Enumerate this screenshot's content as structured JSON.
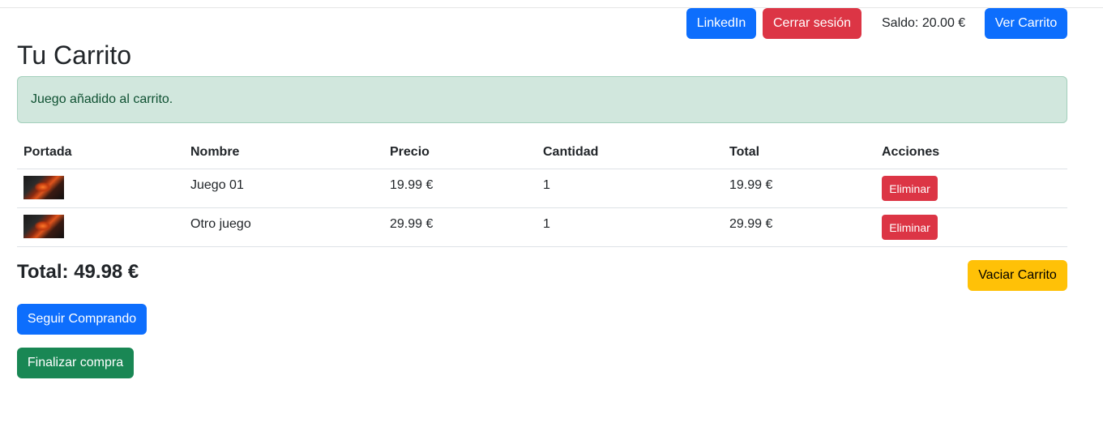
{
  "header": {
    "linkedin_label": "LinkedIn",
    "logout_label": "Cerrar sesión",
    "balance_text": "Saldo: 20.00 €",
    "view_cart_label": "Ver Carrito"
  },
  "page": {
    "title": "Tu Carrito"
  },
  "alert": {
    "message": "Juego añadido al carrito."
  },
  "table": {
    "columns": [
      "Portada",
      "Nombre",
      "Precio",
      "Cantidad",
      "Total",
      "Acciones"
    ],
    "rows": [
      {
        "name": "Juego 01",
        "price": "19.99 €",
        "quantity": "1",
        "total": "19.99 €",
        "action_label": "Eliminar"
      },
      {
        "name": "Otro juego",
        "price": "29.99 €",
        "quantity": "1",
        "total": "29.99 €",
        "action_label": "Eliminar"
      }
    ]
  },
  "summary": {
    "total_text": "Total: 49.98 €",
    "empty_cart_label": "Vaciar Carrito",
    "continue_label": "Seguir Comprando",
    "checkout_label": "Finalizar compra"
  },
  "colors": {
    "primary": "#0d6efd",
    "danger": "#dc3545",
    "warning": "#ffc107",
    "success": "#198754",
    "alert_bg": "#d1e7dd"
  }
}
